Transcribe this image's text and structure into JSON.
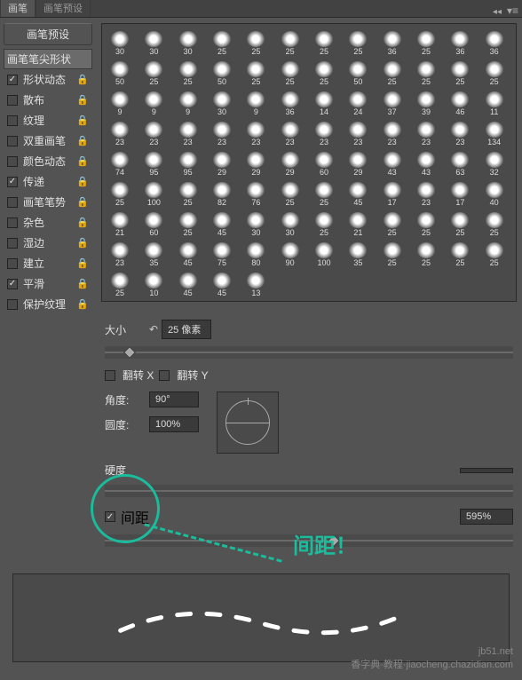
{
  "tabs": {
    "active": "画笔",
    "inactive": "画笔预设"
  },
  "sidebar": {
    "preset_btn": "画笔预设",
    "items": [
      {
        "label": "画笔笔尖形状",
        "checked": null,
        "locked": false,
        "selected": true
      },
      {
        "label": "形状动态",
        "checked": true,
        "locked": true
      },
      {
        "label": "散布",
        "checked": false,
        "locked": true
      },
      {
        "label": "纹理",
        "checked": false,
        "locked": true
      },
      {
        "label": "双重画笔",
        "checked": false,
        "locked": true
      },
      {
        "label": "颜色动态",
        "checked": false,
        "locked": true
      },
      {
        "label": "传递",
        "checked": true,
        "locked": true
      },
      {
        "label": "画笔笔势",
        "checked": false,
        "locked": true
      },
      {
        "label": "杂色",
        "checked": false,
        "locked": true
      },
      {
        "label": "湿边",
        "checked": false,
        "locked": true
      },
      {
        "label": "建立",
        "checked": false,
        "locked": true
      },
      {
        "label": "平滑",
        "checked": true,
        "locked": true
      },
      {
        "label": "保护纹理",
        "checked": false,
        "locked": true
      }
    ]
  },
  "brushes": [
    30,
    30,
    30,
    25,
    25,
    25,
    25,
    25,
    36,
    25,
    36,
    36,
    50,
    25,
    25,
    50,
    25,
    25,
    25,
    50,
    25,
    25,
    25,
    25,
    9,
    9,
    9,
    30,
    9,
    36,
    14,
    24,
    37,
    39,
    46,
    11,
    23,
    23,
    23,
    23,
    23,
    23,
    23,
    23,
    23,
    23,
    23,
    134,
    74,
    95,
    95,
    29,
    29,
    29,
    60,
    29,
    43,
    43,
    63,
    32,
    25,
    100,
    25,
    82,
    76,
    25,
    25,
    45,
    17,
    23,
    17,
    40,
    21,
    60,
    25,
    45,
    30,
    30,
    25,
    21,
    25,
    25,
    25,
    25,
    23,
    35,
    45,
    75,
    80,
    90,
    100,
    35,
    25,
    25,
    25,
    25,
    25,
    10,
    45,
    45,
    13
  ],
  "controls": {
    "size_label": "大小",
    "size_value": "25 像素",
    "flip_x": "翻转 X",
    "flip_y": "翻转 Y",
    "angle_label": "角度:",
    "angle_value": "90°",
    "roundness_label": "圆度:",
    "roundness_value": "100%",
    "hardness_label": "硬度",
    "spacing_label": "间距",
    "spacing_checked": true,
    "spacing_value": "595%"
  },
  "annotation": {
    "text": "间距！"
  },
  "watermark": {
    "line1": "jb51.net",
    "line2": "香字典·教程·jiaocheng.chazidian.com"
  }
}
